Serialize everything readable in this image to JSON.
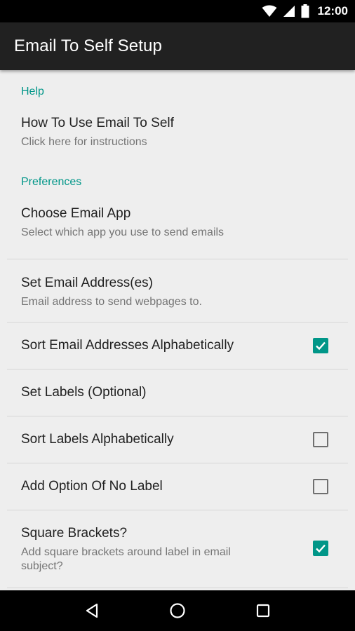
{
  "status_bar": {
    "time": "12:00",
    "icons": [
      "wifi-icon",
      "signal-icon",
      "battery-icon"
    ]
  },
  "app_bar": {
    "title": "Email To Self Setup"
  },
  "sections": {
    "help": {
      "header": "Help",
      "items": [
        {
          "title": "How To Use Email To Self",
          "summary": "Click here for instructions"
        }
      ]
    },
    "preferences": {
      "header": "Preferences",
      "items": [
        {
          "title": "Choose Email App",
          "summary": "Select which app you use to send emails"
        },
        {
          "title": "Set Email Address(es)",
          "summary": "Email address to send webpages to."
        },
        {
          "title": "Sort Email Addresses Alphabetically",
          "checked": true
        },
        {
          "title": "Set Labels (Optional)"
        },
        {
          "title": "Sort Labels Alphabetically",
          "checked": false
        },
        {
          "title": "Add Option Of No Label",
          "checked": false
        },
        {
          "title": "Square Brackets?",
          "summary": "Add square brackets around label in email subject?",
          "checked": true
        }
      ]
    }
  },
  "nav_bar": {
    "icons": [
      "back-icon",
      "home-icon",
      "recents-icon"
    ]
  },
  "colors": {
    "accent": "#009688",
    "app_bar": "#212121",
    "background": "#eeeeee"
  }
}
